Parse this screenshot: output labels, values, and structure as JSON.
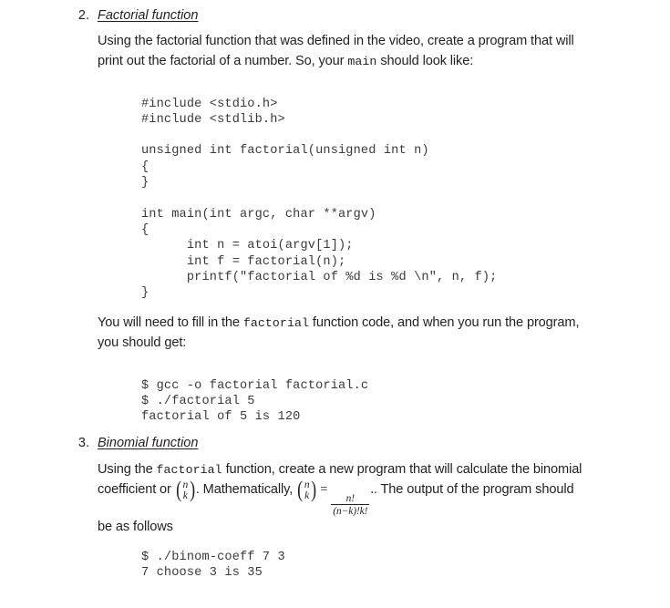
{
  "document": {
    "items": [
      {
        "number": "2.",
        "heading": "Factorial function",
        "paragraph_1_part_1": "Using the factorial function that was defined in the video, create a program that will print out the factorial of a number.  So, your ",
        "paragraph_1_code": "main",
        "paragraph_1_part_2": " should look like:",
        "code_block_1": "#include <stdio.h>\n#include <stdlib.h>\n\nunsigned int factorial(unsigned int n)\n{\n}\n\nint main(int argc, char **argv)\n{\n      int n = atoi(argv[1]);\n      int f = factorial(n);\n      printf(\"factorial of %d is %d \\n\", n, f);\n}",
        "paragraph_2_part_1": "You will need to fill in the ",
        "paragraph_2_code": "factorial",
        "paragraph_2_part_2": " function code, and when you run the program, you should get:",
        "code_block_2": "$ gcc -o factorial factorial.c\n$ ./factorial 5\nfactorial of 5 is 120"
      },
      {
        "number": "3.",
        "heading": "Binomial function",
        "paragraph_1_part_1": "Using the ",
        "paragraph_1_code": "factorial",
        "paragraph_1_part_2": " function, create a new program that will calculate the binomial coefficient or ",
        "paragraph_1_part_3": ".  Mathematically, ",
        "paragraph_1_part_4": ". The output of the program should be as follows",
        "math": {
          "binom_top": "n",
          "binom_bottom": "k",
          "equals": "=",
          "fraction_numerator": "n!",
          "fraction_denominator": "(n−k)!k!",
          "fraction_trailing": "."
        },
        "code_block_1": "$ ./binom-coeff 7 3\n7 choose 3 is 35"
      }
    ]
  }
}
